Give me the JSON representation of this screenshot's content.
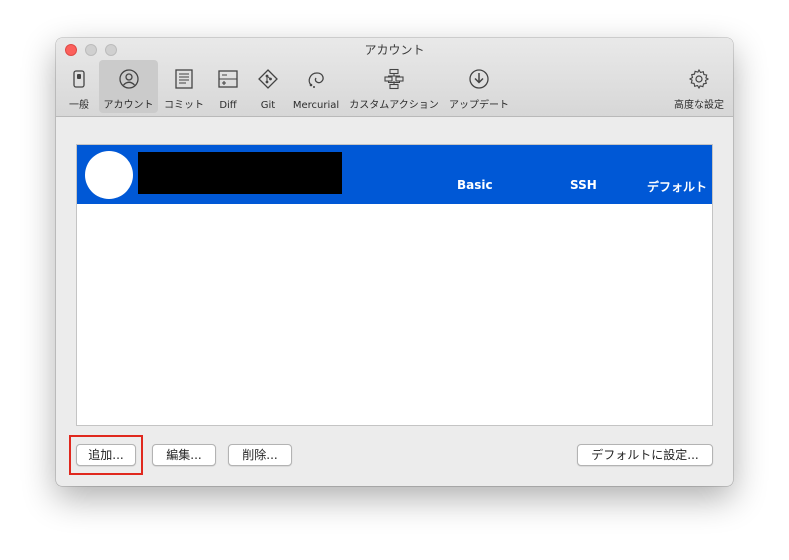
{
  "window": {
    "title": "アカウント"
  },
  "toolbar": {
    "items": [
      {
        "label": "一般",
        "icon": "switch-icon"
      },
      {
        "label": "アカウント",
        "icon": "user-circle-icon",
        "selected": true
      },
      {
        "label": "コミット",
        "icon": "document-lines-icon"
      },
      {
        "label": "Diff",
        "icon": "diff-icon"
      },
      {
        "label": "Git",
        "icon": "git-diamond-icon"
      },
      {
        "label": "Mercurial",
        "icon": "mercurial-icon"
      },
      {
        "label": "カスタムアクション",
        "icon": "flowchart-icon"
      },
      {
        "label": "アップデート",
        "icon": "download-circle-icon"
      },
      {
        "label": "高度な設定",
        "icon": "gear-icon"
      }
    ]
  },
  "accounts": {
    "columns": [
      "Basic",
      "SSH",
      "デフォルト"
    ],
    "selected_color": "#0058d6"
  },
  "buttons": {
    "add": "追加...",
    "edit": "編集...",
    "delete": "削除...",
    "set_default": "デフォルトに設定..."
  },
  "annotation": {
    "highlight_color": "#e0281e"
  }
}
